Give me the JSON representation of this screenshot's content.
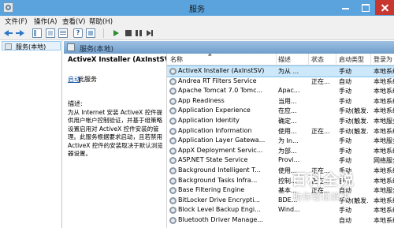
{
  "window": {
    "title": "服务",
    "app_icon": "services-gear-icon"
  },
  "menu": [
    "文件(F)",
    "操作(A)",
    "查看(V)",
    "帮助(H)"
  ],
  "toolbar": {
    "icons": [
      "back-arrow-icon",
      "forward-arrow-icon",
      "show-hide-tree-icon",
      "properties-icon",
      "export-list-icon",
      "help-icon",
      "view-icon",
      "start-service-icon",
      "stop-service-icon",
      "pause-service-icon",
      "restart-service-icon"
    ],
    "help_glyph": "?"
  },
  "tree": {
    "item_label": "服务(本地)"
  },
  "pane_header": {
    "title": "服务(本地)"
  },
  "detail": {
    "service_title": "ActiveX Installer (AxInstSV)",
    "link_text": "启动",
    "link_tail": "此服务",
    "desc_label": "描述:",
    "description": "为从 Internet 安装 ActiveX 控件提供用户帐户控制验证，并基于组策略设置启用对 ActiveX 控件安装的管理。此服务根据要求启动，且若禁用ActiveX 控件的安装取决于默认浏览器设置。"
  },
  "list": {
    "columns": {
      "name": "名称",
      "desc": "描述",
      "state": "状态",
      "startup": "启动类型",
      "logon": "登录为"
    },
    "rows": [
      {
        "name": "ActiveX Installer (AxInstSV)",
        "desc": "为从 ...",
        "state": "",
        "startup": "手动",
        "logon": "本地系统",
        "selected": true
      },
      {
        "name": "Andrea RT Filters Service",
        "desc": "",
        "state": "正在...",
        "startup": "自动",
        "logon": "本地系统",
        "selected": false
      },
      {
        "name": "Apache Tomcat 7.0 Tomc...",
        "desc": "Apac...",
        "state": "",
        "startup": "手动",
        "logon": "本地系统",
        "selected": false
      },
      {
        "name": "App Readiness",
        "desc": "当用...",
        "state": "",
        "startup": "手动",
        "logon": "本地系统",
        "selected": false
      },
      {
        "name": "Application Experience",
        "desc": "在应...",
        "state": "",
        "startup": "手动(触发...",
        "logon": "本地系统",
        "selected": false
      },
      {
        "name": "Application Identity",
        "desc": "确定...",
        "state": "",
        "startup": "手动(触发...",
        "logon": "本地服务",
        "selected": false
      },
      {
        "name": "Application Information",
        "desc": "使用...",
        "state": "正在...",
        "startup": "手动(触发...",
        "logon": "本地系统",
        "selected": false
      },
      {
        "name": "Application Layer Gatewa...",
        "desc": "为 In...",
        "state": "",
        "startup": "手动",
        "logon": "本地服务",
        "selected": false
      },
      {
        "name": "AppX Deployment Servic...",
        "desc": "为部...",
        "state": "",
        "startup": "手动",
        "logon": "本地系统",
        "selected": false
      },
      {
        "name": "ASP.NET State Service",
        "desc": "Provi...",
        "state": "",
        "startup": "手动",
        "logon": "网络服务",
        "selected": false
      },
      {
        "name": "Background Intelligent T...",
        "desc": "使用...",
        "state": "正在...",
        "startup": "手动",
        "logon": "本地系统",
        "selected": false
      },
      {
        "name": "Background Tasks Infra...",
        "desc": "控制...",
        "state": "正在...",
        "startup": "自动",
        "logon": "本地系统",
        "selected": false
      },
      {
        "name": "Base Filtering Engine",
        "desc": "基本...",
        "state": "正在...",
        "startup": "自动",
        "logon": "本地服务",
        "selected": false
      },
      {
        "name": "BitLocker Drive Encrypti...",
        "desc": "BDE...",
        "state": "",
        "startup": "手动(触发...",
        "logon": "本地系统",
        "selected": false
      },
      {
        "name": "Block Level Backup Engi...",
        "desc": "Wind...",
        "state": "",
        "startup": "手动",
        "logon": "本地系统",
        "selected": false
      },
      {
        "name": "Bluetooth Driver Manage...",
        "desc": "",
        "state": "",
        "startup": "自动",
        "logon": "本地系统",
        "selected": false
      }
    ]
  },
  "watermark": {
    "title": "百科全说",
    "subtitle": "助你轻松解决"
  },
  "colors": {
    "titlebar": "#5aa3dd",
    "close": "#c7372f",
    "selection": "#cde8fb",
    "link": "#1e5aa8"
  }
}
